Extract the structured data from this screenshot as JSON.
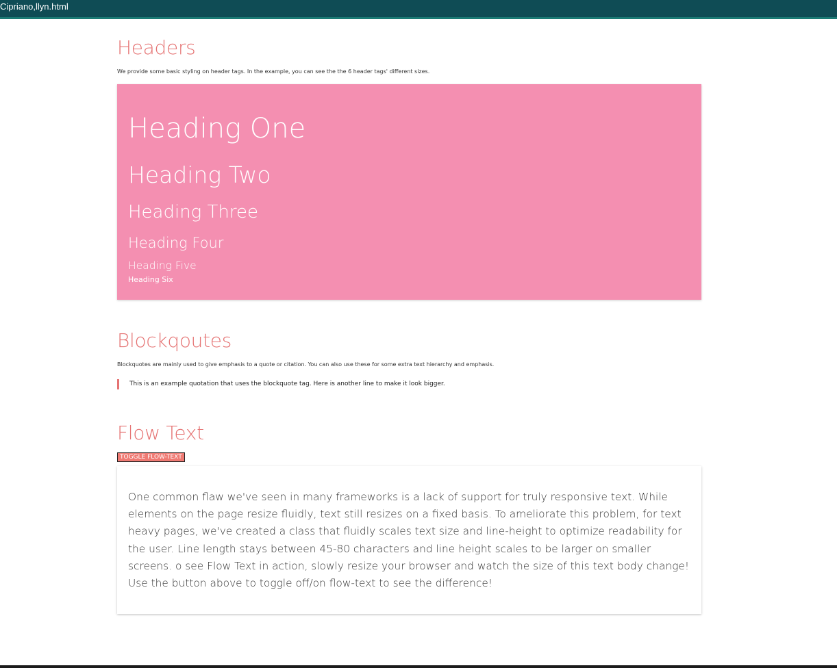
{
  "window": {
    "title": "Cipriano,llyn.html"
  },
  "headers_section": {
    "title": "Headers",
    "description": "We provide some basic styling on header tags. In the example, you can see the the 6 header tags' different sizes.",
    "headings": {
      "h1": "Heading One",
      "h2": "Heading Two",
      "h3": "Heading Three",
      "h4": "Heading Four",
      "h5": "Heading Five",
      "h6": "Heading Six"
    }
  },
  "blockquotes_section": {
    "title": "Blockqoutes",
    "description": "Blockquotes are mainly used to give emphasis to a quote or citation. You can also use these for some extra text hierarchy and emphasis.",
    "quote": "This is an example quotation that uses the blockquote tag. Here is another line to make it look bigger."
  },
  "flow_text_section": {
    "title": "Flow Text",
    "toggle_label": "TOGGLE FLOW-TEXT",
    "body": "One common flaw we've seen in many frameworks is a lack of support for truly responsive text. While elements on the page resize fluidly, text still resizes on a fixed basis. To ameliorate this problem, for text heavy pages, we've created a class that fluidly scales text size and line-height to optimize readability for the user. Line length stays between 45-80 characters and line height scales to be larger on smaller screens. o see Flow Text in action, slowly resize your browser and watch the size of this text body change! Use the button above to toggle off/on flow-text to see the difference!"
  },
  "colors": {
    "titlebar": "#0f4c55",
    "accent": "#e57373",
    "panel": "#f48fb1",
    "button": "#ef7a73"
  }
}
